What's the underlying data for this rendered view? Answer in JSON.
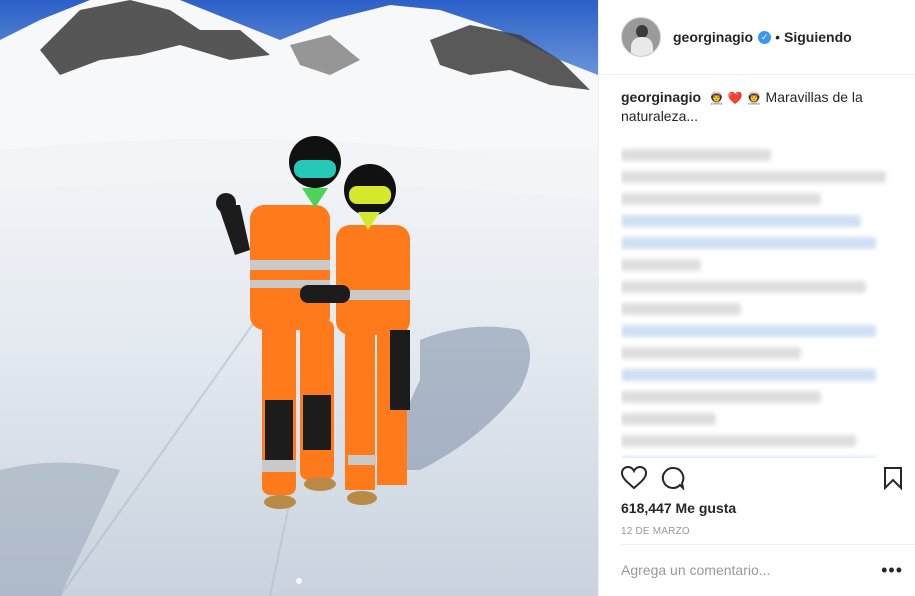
{
  "header": {
    "username": "georginagio",
    "separator": "•",
    "follow_label": "Siguiendo",
    "verified_icon": "checkmark"
  },
  "caption": {
    "username": "georginagio",
    "emoji": [
      "👨‍🚀",
      "❤️",
      "👨‍🚀"
    ],
    "text": "Maravillas de la naturaleza..."
  },
  "actions": {
    "like_icon": "heart-icon",
    "comment_icon": "comment-bubble-icon",
    "save_icon": "bookmark-icon"
  },
  "likes_label": "618,447 Me gusta",
  "date_label": "12 DE MARZO",
  "comment_placeholder": "Agrega un comentario...",
  "options_label": "•••",
  "carousel": {
    "pages": 1,
    "active": 1
  },
  "colors": {
    "accent": "#3897f0",
    "text": "#262626",
    "muted": "#999999",
    "suit_orange": "#ff7a1a"
  }
}
